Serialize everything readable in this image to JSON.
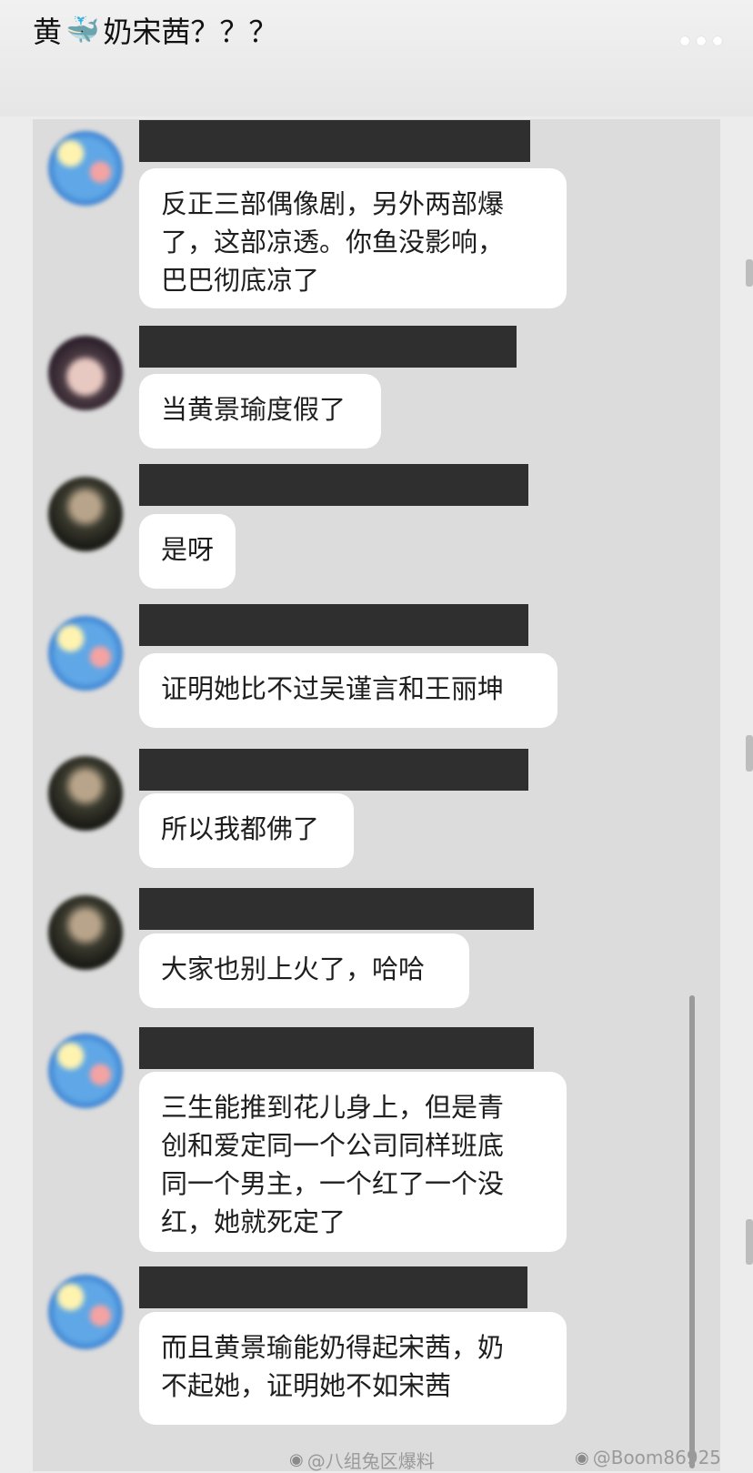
{
  "header": {
    "title_prefix": "黄",
    "title_emoji": "🐳",
    "title_suffix": "奶宋茜？？？"
  },
  "messages": [
    {
      "avatar": "blue",
      "text": "反正三部偶像剧，另外两部爆\n了，这部凉透。你鱼没影响，\n巴巴彻底凉了"
    },
    {
      "avatar": "woman",
      "text": "当黄景瑜度假了"
    },
    {
      "avatar": "dark",
      "text": "是呀"
    },
    {
      "avatar": "blue",
      "text": "证明她比不过吴谨言和王丽坤"
    },
    {
      "avatar": "dark",
      "text": "所以我都佛了"
    },
    {
      "avatar": "dark",
      "text": "大家也别上火了，哈哈"
    },
    {
      "avatar": "blue",
      "text": "三生能推到花儿身上，但是青\n创和爱定同一个公司同样班底\n同一个男主，一个红了一个没\n红，她就死定了"
    },
    {
      "avatar": "blue",
      "text": "而且黄景瑜能奶得起宋茜，奶\n不起她，证明她不如宋茜"
    }
  ],
  "watermarks": {
    "left": "@八组兔区爆料",
    "right": "@Boom86925"
  }
}
